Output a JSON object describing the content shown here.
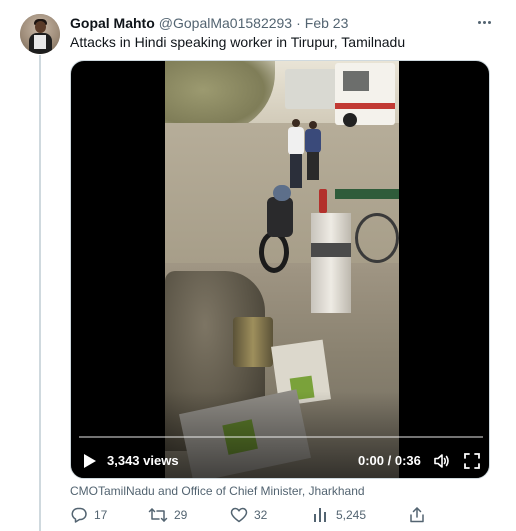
{
  "tweet": {
    "author_name": "Gopal Mahto",
    "handle": "@GopalMa01582293",
    "separator": "·",
    "date": "Feb 23",
    "text": "Attacks in Hindi speaking worker in Tirupur, Tamilnadu"
  },
  "video": {
    "views": "3,343 views",
    "time": "0:00 / 0:36",
    "progress": 0
  },
  "tagged_text": "CMOTamilNadu and Office of Chief Minister, Jharkhand",
  "actions": {
    "replies": "17",
    "retweets": "29",
    "likes": "32",
    "views": "5,245"
  },
  "icons": {
    "more": "more-horizontal-icon",
    "play": "play-icon",
    "volume": "volume-icon",
    "fullscreen": "fullscreen-icon",
    "reply": "reply-icon",
    "retweet": "retweet-icon",
    "like": "heart-icon",
    "analytics": "analytics-icon",
    "share": "share-icon"
  },
  "colors": {
    "text_primary": "#0f1419",
    "text_secondary": "#536471",
    "border": "#cfd9de"
  }
}
